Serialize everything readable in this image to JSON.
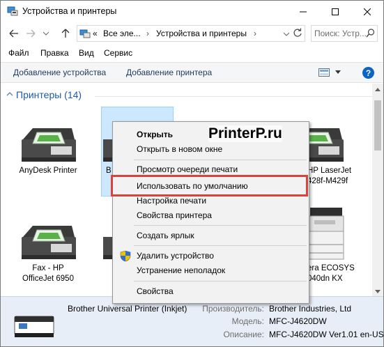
{
  "window": {
    "title": "Устройства и принтеры"
  },
  "address": {
    "overflow": "«",
    "crumb1": "Все эле...",
    "sep1": "›",
    "crumb2": "Устройства и принтеры",
    "sep2": "›"
  },
  "search": {
    "placeholder": "Поиск: Устр..."
  },
  "menu": [
    "Файл",
    "Правка",
    "Вид",
    "Сервис"
  ],
  "commands": {
    "add_device": "Добавление устройства",
    "add_printer": "Добавление принтера"
  },
  "help": "?",
  "group": {
    "title": "Принтеры (14)"
  },
  "devices": [
    {
      "label_1": "AnyDesk Printer",
      "label_2": ""
    },
    {
      "label_1": "B",
      "label_2": ""
    },
    {
      "label_1": "HP LaserJet",
      "label_2": "428f-M429f"
    },
    {
      "label_1": "Fax - HP",
      "label_2": "OfficeJet 6950"
    },
    {
      "label_1": "era ECOSYS",
      "label_2": "040dn KX"
    }
  ],
  "details": {
    "name": "Brother Universal Printer (Inkjet)",
    "manufacturer_label": "Производитель:",
    "manufacturer_value": "Brother Industries, Ltd",
    "model_label": "Модель:",
    "model_value": "MFC-J4620DW",
    "description_label": "Описание:",
    "description_value": "MFC-J4620DW Ver1.01 en-US"
  },
  "context_menu": {
    "open": "Открыть",
    "open_new": "Открыть в новом окне",
    "queue": "Просмотр очереди печати",
    "set_default": "Использовать по умолчанию",
    "print_prefs": "Настройка печати",
    "printer_props": "Свойства принтера",
    "shortcut": "Создать ярлык",
    "remove": "Удалить устройство",
    "troubleshoot": "Устранение неполадок",
    "properties": "Свойства"
  },
  "watermark": "PrinterP.ru",
  "colors": {
    "highlight_border": "#e0403a",
    "selection": "#cce8ff",
    "group_title": "#1e5ba8",
    "help": "#0a64c8"
  }
}
